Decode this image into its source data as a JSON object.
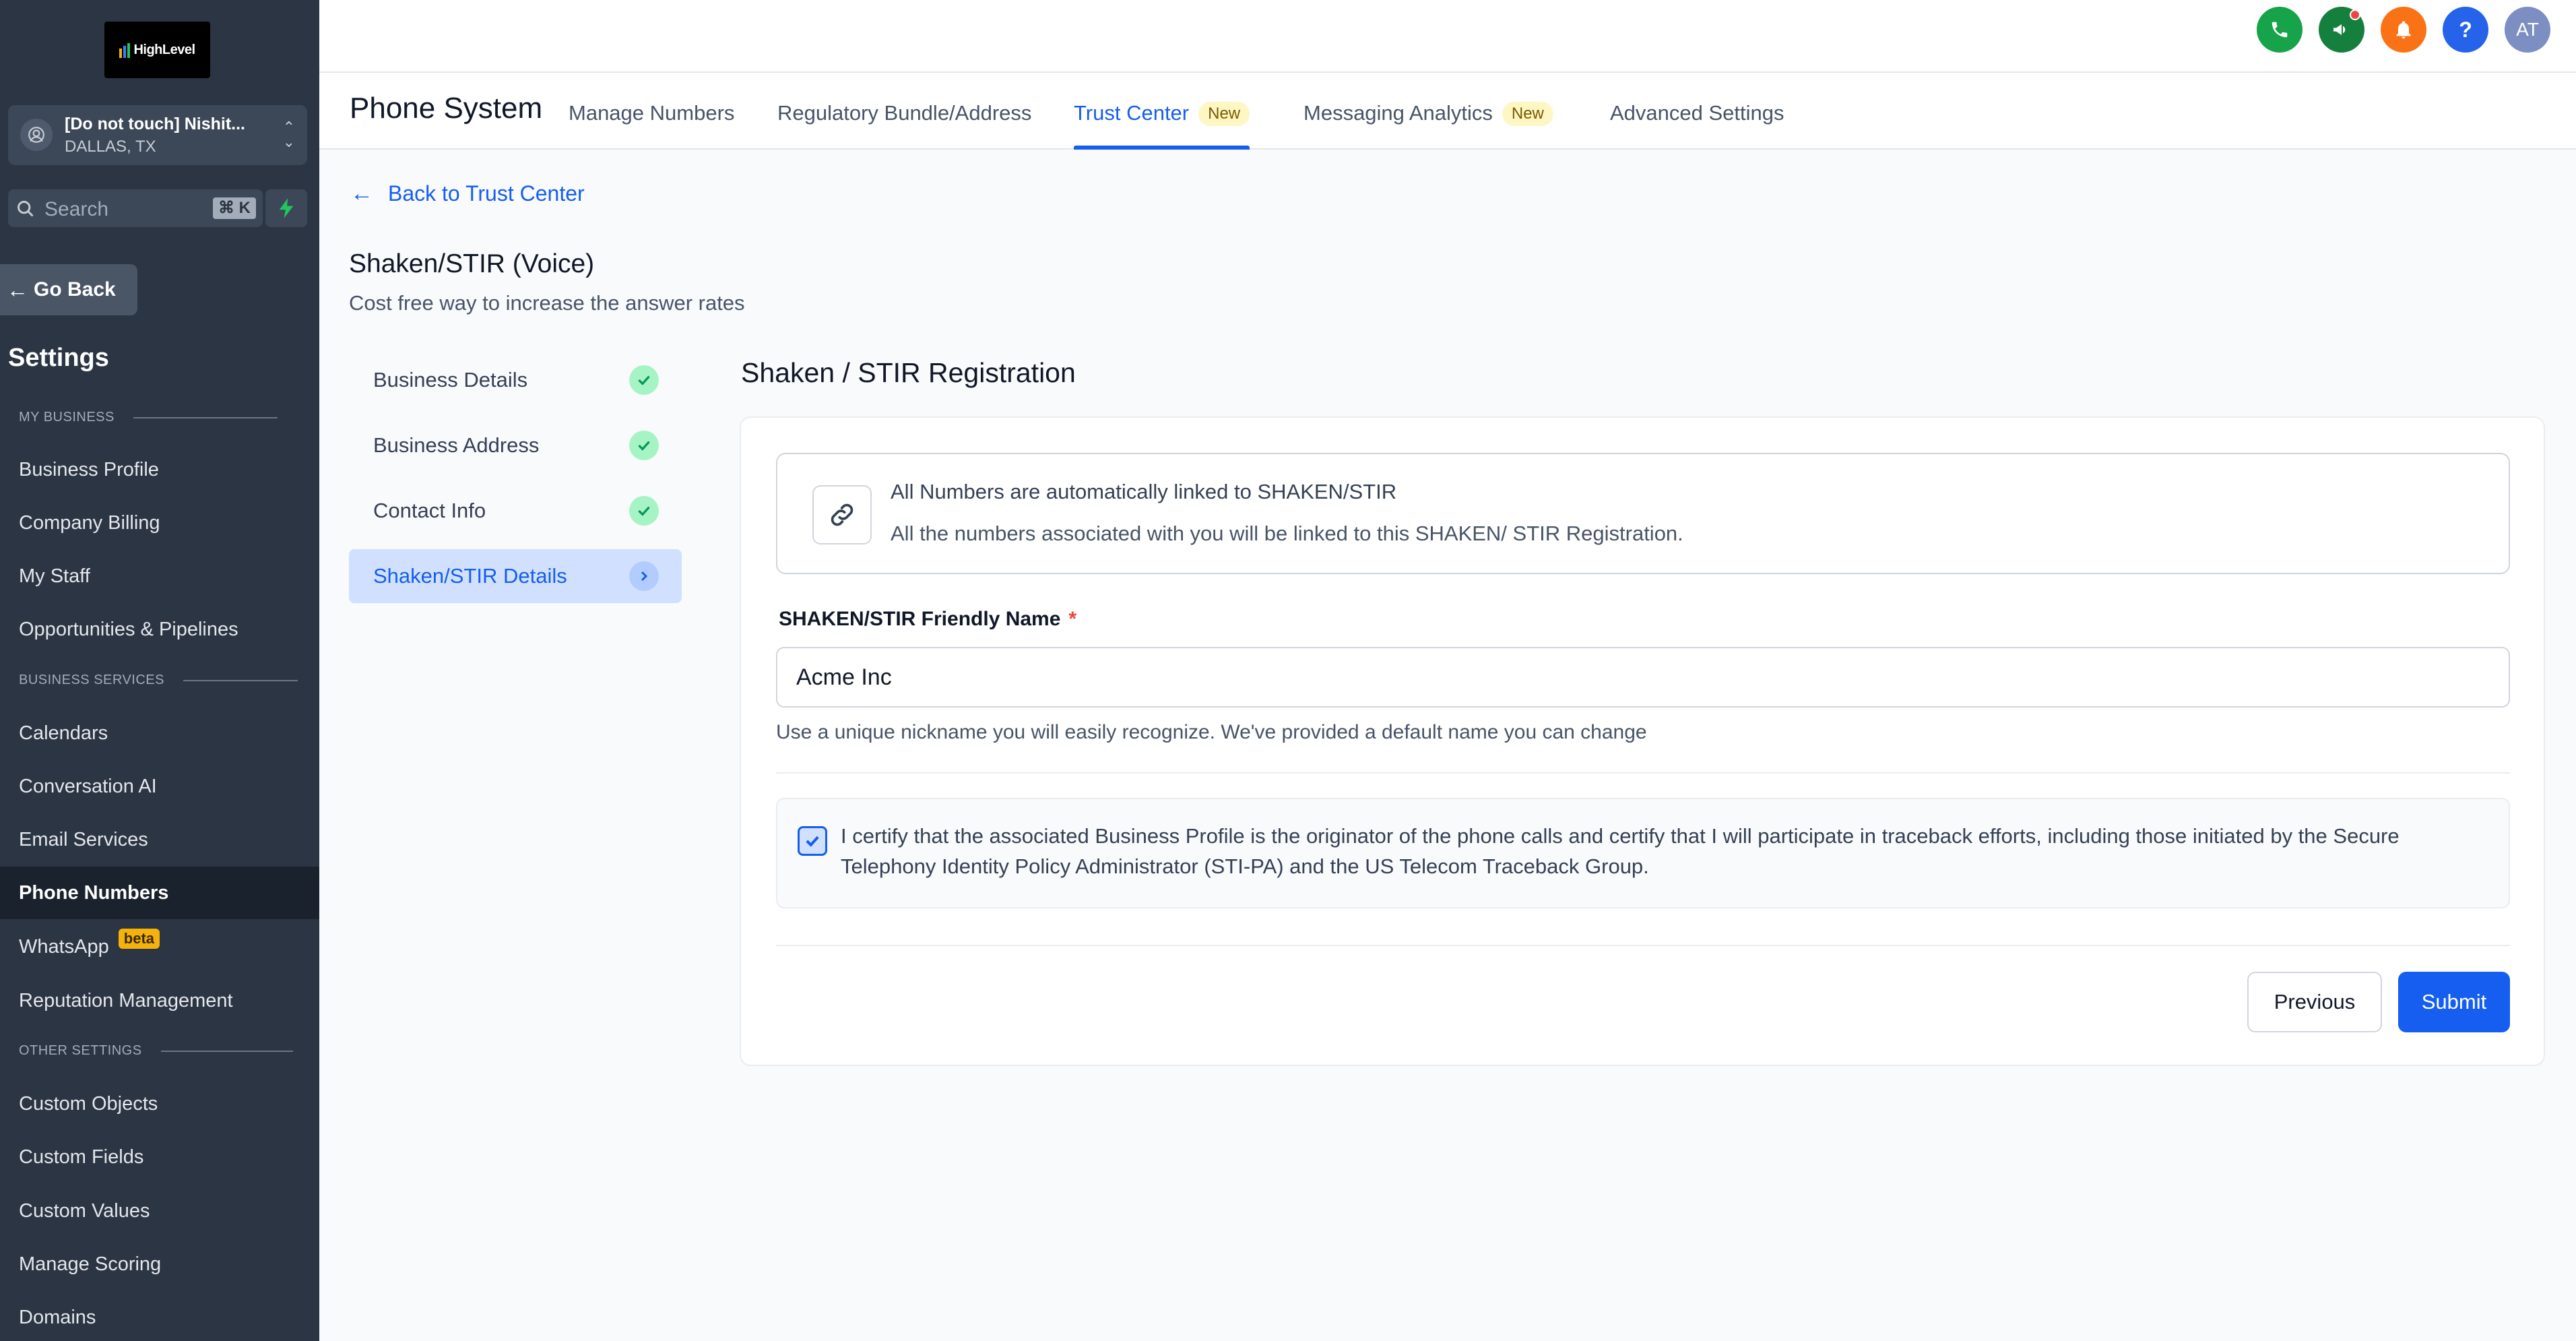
{
  "sidebar": {
    "logo_text": "HighLevel",
    "location": {
      "name": "[Do not touch] Nishit...",
      "city": "DALLAS, TX"
    },
    "search": {
      "placeholder": "Search",
      "shortcut": "⌘ K"
    },
    "go_back": "Go Back",
    "settings_title": "Settings",
    "sections": [
      {
        "header": "MY BUSINESS",
        "items": [
          "Business Profile",
          "Company Billing",
          "My Staff",
          "Opportunities & Pipelines"
        ]
      },
      {
        "header": "BUSINESS SERVICES",
        "items": [
          "Calendars",
          "Conversation AI",
          "Email Services",
          "Phone Numbers",
          "WhatsApp",
          "Reputation Management"
        ]
      },
      {
        "header": "OTHER SETTINGS",
        "items": [
          "Custom Objects",
          "Custom Fields",
          "Custom Values",
          "Manage Scoring",
          "Domains"
        ]
      }
    ],
    "active_item": "Phone Numbers",
    "whatsapp_badge": "beta"
  },
  "topbar": {
    "avatar_initials": "AT",
    "help_glyph": "?",
    "icons": [
      "phone-icon",
      "megaphone-icon",
      "bell-icon",
      "help-icon",
      "avatar"
    ]
  },
  "tabbar": {
    "title": "Phone System",
    "tabs": [
      {
        "label": "Manage Numbers",
        "badge": ""
      },
      {
        "label": "Regulatory Bundle/Address",
        "badge": ""
      },
      {
        "label": "Trust Center",
        "badge": "New"
      },
      {
        "label": "Messaging Analytics",
        "badge": "New"
      },
      {
        "label": "Advanced Settings",
        "badge": ""
      }
    ],
    "active_tab": "Trust Center"
  },
  "main": {
    "back_link": "Back to Trust Center",
    "heading": "Shaken/STIR (Voice)",
    "subheading": "Cost free way to increase the answer rates",
    "steps": [
      {
        "label": "Business Details",
        "status": "complete"
      },
      {
        "label": "Business Address",
        "status": "complete"
      },
      {
        "label": "Contact Info",
        "status": "complete"
      },
      {
        "label": "Shaken/STIR Details",
        "status": "current"
      }
    ],
    "form_title": "Shaken / STIR Registration",
    "info": {
      "title": "All Numbers are automatically linked to SHAKEN/STIR",
      "desc": "All the numbers associated with you will be linked to this SHAKEN/ STIR Registration."
    },
    "field": {
      "label": "SHAKEN/STIR Friendly Name",
      "required_mark": "*",
      "value": "Acme Inc",
      "help": "Use a unique nickname you will easily recognize. We've provided a default name you can change"
    },
    "certify": {
      "checked": true,
      "text": "I certify that the associated Business Profile is the originator of the phone calls and certify that I will participate in traceback efforts, including those initiated by the Secure Telephony Identity Policy Administrator (STI-PA) and the US Telecom Traceback Group."
    },
    "buttons": {
      "previous": "Previous",
      "submit": "Submit"
    }
  },
  "colors": {
    "sidebar_bg": "#2b3544",
    "primary": "#155eef",
    "badge_new_bg": "#fef7c3",
    "beta_badge": "#f5b20a",
    "phone_icon": "#16a34a",
    "megaphone_icon": "#15803d",
    "bell_icon": "#f97316",
    "help_icon": "#2563eb",
    "avatar_bg": "#7c8ec2"
  }
}
